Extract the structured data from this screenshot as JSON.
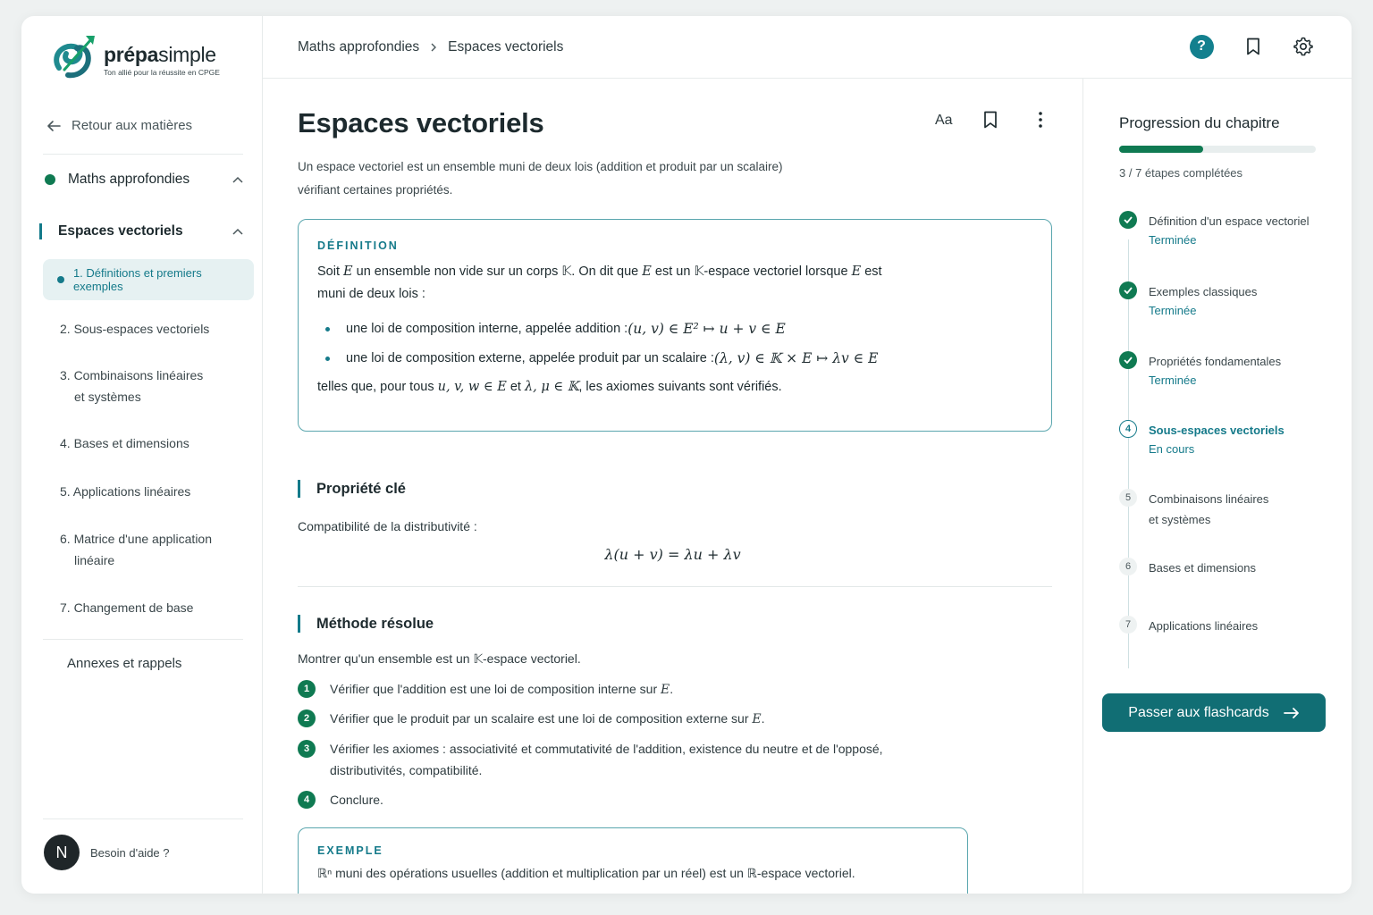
{
  "brand": {
    "name_bold": "prépa",
    "name_light": "simple",
    "tagline": "Ton allié pour la réussite en CPGE"
  },
  "sidebar": {
    "back_label": "Retour aux matières",
    "subject": "Maths approfondies",
    "chapter": "Espaces vectoriels",
    "active_section": "1. Définitions et premiers exemples",
    "sections": [
      {
        "line1": "2. Sous-espaces vectoriels",
        "line2": ""
      },
      {
        "line1": "3. Combinaisons linéaires",
        "line2": "et systèmes"
      },
      {
        "line1": "4. Bases et dimensions",
        "line2": ""
      },
      {
        "line1": "5. Applications linéaires",
        "line2": ""
      },
      {
        "line1": "6. Matrice d'une application",
        "line2": "linéaire"
      },
      {
        "line1": "7. Changement de base",
        "line2": ""
      }
    ],
    "annexes": "Annexes et rappels",
    "avatar_initial": "N",
    "help_label": "Besoin d'aide ?"
  },
  "header": {
    "breadcrumb": [
      "Maths approfondies",
      "Espaces vectoriels"
    ],
    "icons": [
      "help-icon",
      "bookmark-icon",
      "settings-icon"
    ],
    "help_glyph": "?"
  },
  "main": {
    "title": "Espaces vectoriels",
    "font_toggle": "Aa",
    "intro_1": "Un espace vectoriel est un ensemble muni de deux lois (addition et produit par un scalaire)",
    "intro_2": "vérifiant certaines propriétés.",
    "definition": {
      "kicker": "DÉFINITION",
      "p1a": "Soit ",
      "p1b": "E",
      "p1c": " un ensemble non vide sur un corps ",
      "p1d": "𝕂",
      "p1e": ". On dit que ",
      "p1f": "E",
      "p1g": " est un ",
      "p1h": "𝕂",
      "p1i": "-espace vectoriel lorsque ",
      "p1j": "E",
      "p1k": " est",
      "p2": "muni de deux lois :",
      "bullet1_text": "une loi de composition interne, appelée addition : ",
      "bullet1_math": "(u, v) ∈ E² ↦ u + v ∈ E",
      "bullet2_text": "une loi de composition externe, appelée produit par un scalaire : ",
      "bullet2_math": "(λ, v) ∈ 𝕂 × E ↦ λv ∈ E",
      "end_a": "telles que, pour tous ",
      "end_b": "u, v, w ∈ E",
      "end_c": " et ",
      "end_d": "λ, μ ∈ 𝕂",
      "end_e": ", les axiomes suivants sont vérifiés."
    },
    "property": {
      "heading": "Propriété clé",
      "text": "Compatibilité de la distributivité :",
      "formula": "λ(u + v) = λu + λv"
    },
    "method": {
      "heading": "Méthode résolue",
      "intro_a": "Montrer qu'un ensemble est un ",
      "intro_b": "𝕂",
      "intro_c": "-espace vectoriel.",
      "steps": [
        {
          "n": "1",
          "a": "Vérifier que l'addition est une loi de composition interne sur ",
          "b": "E",
          "c": ".",
          "line2": ""
        },
        {
          "n": "2",
          "a": "Vérifier que le produit par un scalaire est une loi de composition externe sur ",
          "b": "E",
          "c": ".",
          "line2": ""
        },
        {
          "n": "3",
          "a": "Vérifier les axiomes : associativité et commutativité de l'addition, existence du neutre et de l'opposé,",
          "b": "",
          "c": "",
          "line2": "distributivités, compatibilité."
        },
        {
          "n": "4",
          "a": "Conclure.",
          "b": "",
          "c": "",
          "line2": ""
        }
      ]
    },
    "example": {
      "kicker": "EXEMPLE",
      "a": "ℝⁿ",
      "b": " muni des opérations usuelles (addition et multiplication par un réel) est un ",
      "c": "ℝ",
      "d": "-espace vectoriel."
    }
  },
  "progress": {
    "title": "Progression du chapitre",
    "completed": 3,
    "total": 7,
    "count_label": "3 / 7 étapes complétées",
    "steps": [
      {
        "n": "1",
        "title": "Définition d'un espace vectoriel",
        "title2": "",
        "status": "Terminée",
        "state": "done"
      },
      {
        "n": "2",
        "title": "Exemples classiques",
        "title2": "",
        "status": "Terminée",
        "state": "done"
      },
      {
        "n": "3",
        "title": "Propriétés fondamentales",
        "title2": "",
        "status": "Terminée",
        "state": "done"
      },
      {
        "n": "4",
        "title": "Sous-espaces vectoriels",
        "title2": "",
        "status": "En cours",
        "state": "current"
      },
      {
        "n": "5",
        "title": "Combinaisons linéaires",
        "title2": "et systèmes",
        "status": "",
        "state": "todo"
      },
      {
        "n": "6",
        "title": "Bases et dimensions",
        "title2": "",
        "status": "",
        "state": "todo"
      },
      {
        "n": "7",
        "title": "Applications linéaires",
        "title2": "",
        "status": "",
        "state": "todo"
      }
    ],
    "cta_label": "Passer aux flashcards"
  },
  "colors": {
    "accent": "#157a8a",
    "green": "#0f7a52",
    "cta": "#116e74"
  }
}
